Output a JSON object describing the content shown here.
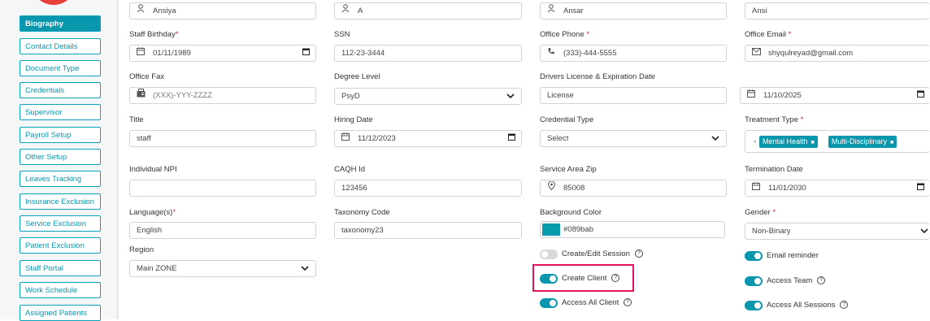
{
  "sidebar": {
    "items": [
      {
        "label": "Biography",
        "active": true
      },
      {
        "label": "Contact Details"
      },
      {
        "label": "Document Type"
      },
      {
        "label": "Credentials"
      },
      {
        "label": "Supervisor"
      },
      {
        "label": "Payroll Setup"
      },
      {
        "label": "Other Setup"
      },
      {
        "label": "Leaves Tracking"
      },
      {
        "label": "Insurance Exclusion"
      },
      {
        "label": "Service Exclusion"
      },
      {
        "label": "Patient Exclusion"
      },
      {
        "label": "Staff Portal"
      },
      {
        "label": "Work Schedule"
      },
      {
        "label": "Assigned Patients"
      }
    ]
  },
  "form": {
    "first_name": "Ansiya",
    "middle_name": "A",
    "last_name": "Ansar",
    "nick_name": "Ansi",
    "staff_birthday": {
      "label": "Staff Birthday",
      "required": "*",
      "value": "01/11/1989"
    },
    "ssn": {
      "label": "SSN",
      "value": "112-23-3444"
    },
    "office_phone": {
      "label": "Office Phone",
      "required": " *",
      "value": "(333)-444-5555"
    },
    "office_email": {
      "label": "Office Email",
      "required": " *",
      "value": "shyqulreyad@gmail.com"
    },
    "office_fax": {
      "label": "Office Fax",
      "placeholder": "(XXX)-YYY-ZZZZ"
    },
    "degree_level": {
      "label": "Degree Level",
      "value": "PsyD"
    },
    "drivers_license": {
      "label": "Drivers License & Expiration Date",
      "value": "License",
      "date": "11/10/2025"
    },
    "title": {
      "label": "Title",
      "value": "staff"
    },
    "hiring_date": {
      "label": "Hiring Date",
      "value": "11/12/2023"
    },
    "credential_type": {
      "label": "Credential Type",
      "value": "Select"
    },
    "treatment_type": {
      "label": "Treatment Type",
      "required": " *",
      "prefix": "-",
      "chips": [
        "Mental Health",
        "Multi-Disciplinary"
      ]
    },
    "individual_npi": {
      "label": "Individual NPI",
      "value": ""
    },
    "caqh_id": {
      "label": "CAQH Id",
      "value": "123456"
    },
    "service_area_zip": {
      "label": "Service Area Zip",
      "value": "85008"
    },
    "termination_date": {
      "label": "Termination Date",
      "value": "11/01/2030"
    },
    "languages": {
      "label": "Language(s)",
      "required": "*",
      "value": "English"
    },
    "taxonomy_code": {
      "label": "Taxonomy Code",
      "value": "taxonomy23"
    },
    "background_color": {
      "label": "Background Color",
      "value": "#089bab",
      "swatch": "#089bab"
    },
    "gender": {
      "label": "Gender",
      "required": " *",
      "value": "Non-Binary"
    },
    "region": {
      "label": "Region",
      "value": "Main ZONE"
    }
  },
  "toggles": {
    "create_edit_session": {
      "label": "Create/Edit Session",
      "on": false
    },
    "create_client": {
      "label": "Create Client",
      "on": true
    },
    "access_all_client": {
      "label": "Access All Client",
      "on": true
    },
    "email_reminder": {
      "label": "Email reminder",
      "on": true
    },
    "access_team": {
      "label": "Access Team",
      "on": true
    },
    "access_all_sessions": {
      "label": "Access All Sessions",
      "on": true
    }
  },
  "icons": {
    "help": "?",
    "chip_remove": "■"
  },
  "colors": {
    "accent": "#0a97ad",
    "highlight": "#e0155d",
    "required": "#d9242c"
  }
}
